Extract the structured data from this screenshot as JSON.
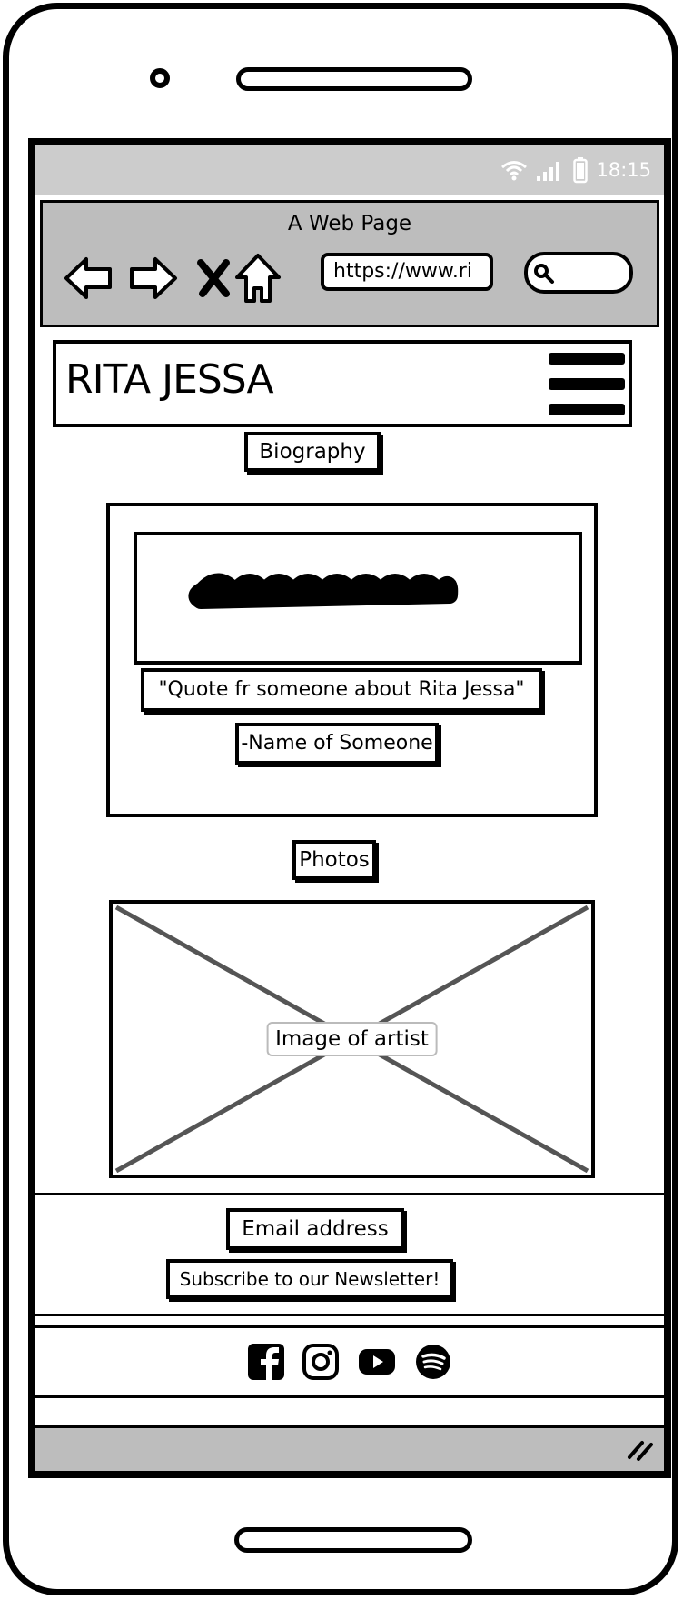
{
  "status_bar": {
    "time": "18:15"
  },
  "browser": {
    "title": "A Web Page",
    "url": "https://www.ri"
  },
  "header": {
    "site_title": "RITA JESSA"
  },
  "biography": {
    "heading": "Biography",
    "quote": "\"Quote fr someone about Rita Jessa\"",
    "attribution": "-Name of Someone"
  },
  "photos": {
    "heading": "Photos",
    "image_caption": "Image of artist"
  },
  "newsletter": {
    "email_label": "Email address",
    "subscribe_label": "Subscribe to our Newsletter!"
  },
  "social": {
    "icons": [
      "facebook-icon",
      "instagram-icon",
      "youtube-icon",
      "spotify-icon"
    ]
  },
  "colors": {
    "chrome_gray": "#bdbdbd",
    "status_gray": "#cccccc",
    "ink": "#000000",
    "placeholder_line": "#555555"
  }
}
